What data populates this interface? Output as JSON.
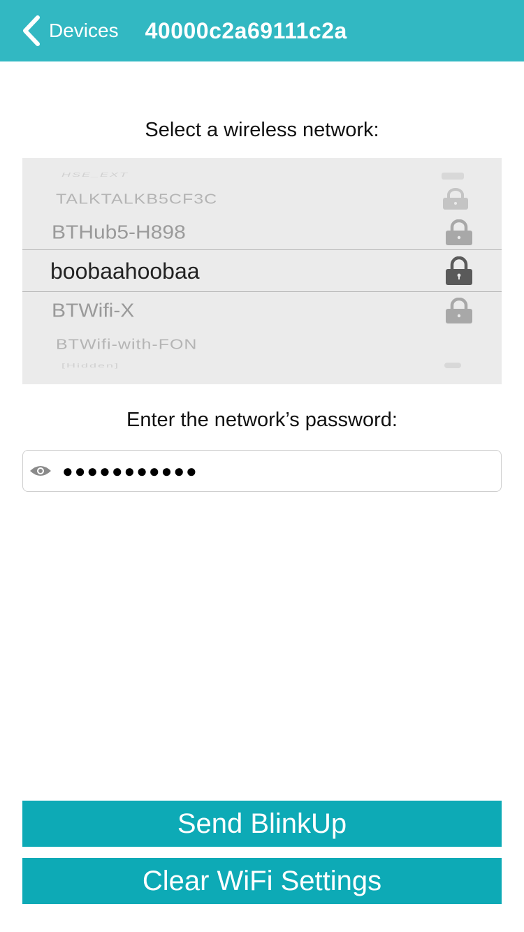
{
  "nav": {
    "back_label": "Devices",
    "title": "40000c2a69111c2a",
    "bar_color": "#32b8c2"
  },
  "network_section": {
    "heading": "Select a wireless network:",
    "networks": [
      {
        "label": "HSE_EXT",
        "locked": true
      },
      {
        "label": "TALKTALKB5CF3C",
        "locked": true
      },
      {
        "label": "BTHub5-H898",
        "locked": true
      },
      {
        "label": "boobaahoobaa",
        "locked": true,
        "selected": true
      },
      {
        "label": "BTWifi-X",
        "locked": true
      },
      {
        "label": "BTWifi-with-FON",
        "locked": false
      },
      {
        "label": "[Hidden]",
        "locked": true
      }
    ]
  },
  "password_section": {
    "heading": "Enter the network’s password:",
    "value": "●●●●●●●●●●●",
    "toggle_icon": "eye-icon"
  },
  "buttons": {
    "send_label": "Send BlinkUp",
    "clear_label": "Clear WiFi Settings",
    "color": "#0daab6"
  }
}
